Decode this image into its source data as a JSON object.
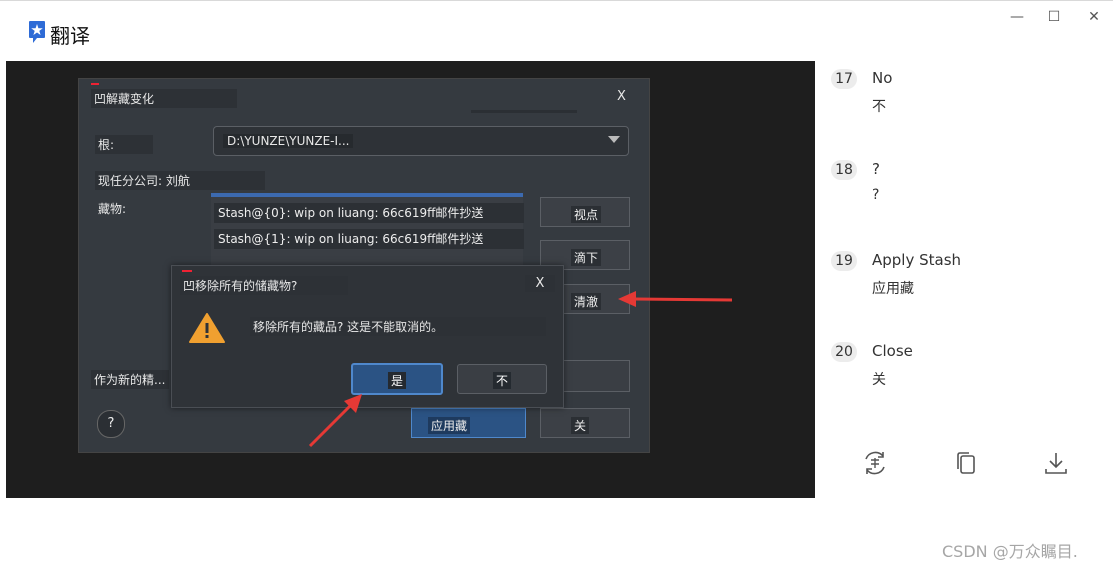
{
  "app": {
    "title": "翻译"
  },
  "window_controls": {
    "minimize": "—",
    "maximize": "☐",
    "close": "✕"
  },
  "dialog": {
    "title": "凹解藏变化",
    "close": "X",
    "root_label": "根:",
    "root_value": "D:\\YUNZE\\YUNZE-I...",
    "branch_label": "现任分公司: 刘航",
    "stash_label": "藏物:",
    "stashes": [
      "Stash@{0}: wip on liuang: 66c619ff邮件抄送",
      "Stash@{1}: wip on liuang: 66c619ff邮件抄送"
    ],
    "buttons": {
      "view": "视点",
      "drop": "滴下",
      "clear": "清澈",
      "apply": "应用藏",
      "close": "关"
    },
    "new_branch_label": "作为新的精...",
    "help": "?"
  },
  "confirm": {
    "title": "凹移除所有的储藏物?",
    "close": "X",
    "message": "移除所有的藏品? 这是不能取消的。",
    "yes": "是",
    "no": "不"
  },
  "translations": [
    {
      "num": "17",
      "en": "No",
      "zh": "不"
    },
    {
      "num": "18",
      "en": "?",
      "zh": "?"
    },
    {
      "num": "19",
      "en": "Apply Stash",
      "zh": "应用藏"
    },
    {
      "num": "20",
      "en": "Close",
      "zh": "关"
    }
  ],
  "toolbar_icons": [
    "translate-icon",
    "copy-icon",
    "download-icon"
  ],
  "watermark": "CSDN @万众瞩目.",
  "colors": {
    "accent": "#2b5384",
    "arrow": "#e53935",
    "logo": "#2e6bd6"
  }
}
